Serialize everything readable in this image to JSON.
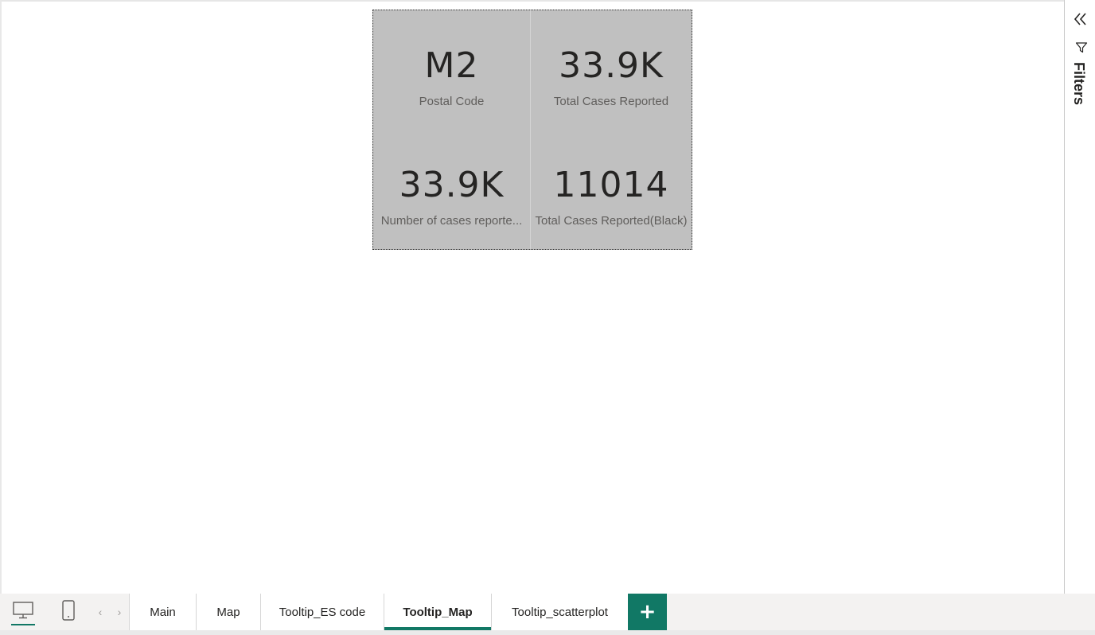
{
  "cards": [
    {
      "value": "M2",
      "label": "Postal Code"
    },
    {
      "value": "33.9K",
      "label": "Total Cases Reported"
    },
    {
      "value": "33.9K",
      "label": "Number of cases reporte..."
    },
    {
      "value": "11014",
      "label": "Total Cases Reported(Black)"
    }
  ],
  "filters": {
    "label": "Filters",
    "collapse_icon": "double-chevron-left-icon",
    "funnel_icon": "funnel-icon"
  },
  "tab_bar": {
    "view_buttons": [
      {
        "name": "desktop-view-icon",
        "selected": true
      },
      {
        "name": "mobile-view-icon",
        "selected": false
      }
    ],
    "tabs": [
      {
        "label": "Main",
        "active": false
      },
      {
        "label": "Map",
        "active": false
      },
      {
        "label": "Tooltip_ES code",
        "active": false
      },
      {
        "label": "Tooltip_Map",
        "active": true
      },
      {
        "label": "Tooltip_scatterplot",
        "active": false
      }
    ],
    "add_label": "+"
  },
  "colors": {
    "accent": "#117865",
    "card_background": "#c0c0c0",
    "value_text": "#252423",
    "label_text": "#605e5c"
  }
}
